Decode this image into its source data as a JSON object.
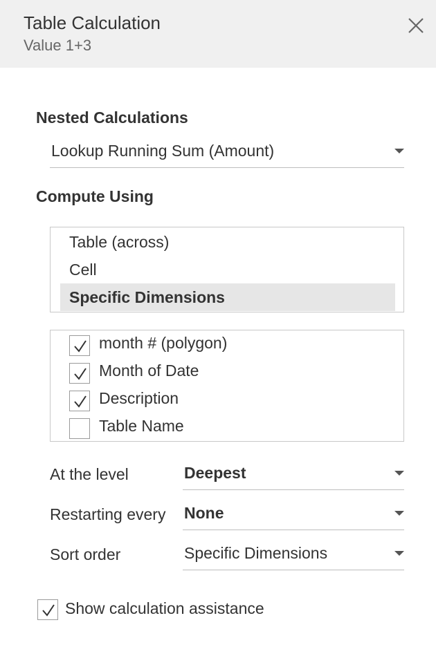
{
  "header": {
    "title": "Table Calculation",
    "subtitle": "Value 1+3",
    "close_icon": "close-icon"
  },
  "nested": {
    "label": "Nested Calculations",
    "value": "Lookup Running Sum (Amount)"
  },
  "compute": {
    "label": "Compute Using",
    "options": [
      {
        "label": "Table (across)",
        "selected": false
      },
      {
        "label": "Cell",
        "selected": false
      },
      {
        "label": "Specific Dimensions",
        "selected": true
      }
    ],
    "dimensions": [
      {
        "label": "month # (polygon)",
        "checked": true
      },
      {
        "label": "Month of Date",
        "checked": true
      },
      {
        "label": "Description",
        "checked": true
      },
      {
        "label": "Table Name",
        "checked": false
      }
    ]
  },
  "fields": {
    "level": {
      "label": "At the level",
      "value": "Deepest"
    },
    "restart": {
      "label": "Restarting every",
      "value": "None"
    },
    "sort": {
      "label": "Sort order",
      "value": "Specific Dimensions"
    }
  },
  "assistance": {
    "label": "Show calculation assistance",
    "checked": true
  },
  "colors": {
    "header_bg": "#f0f0f0",
    "selected_bg": "#e6e6e6",
    "text": "#333333"
  }
}
